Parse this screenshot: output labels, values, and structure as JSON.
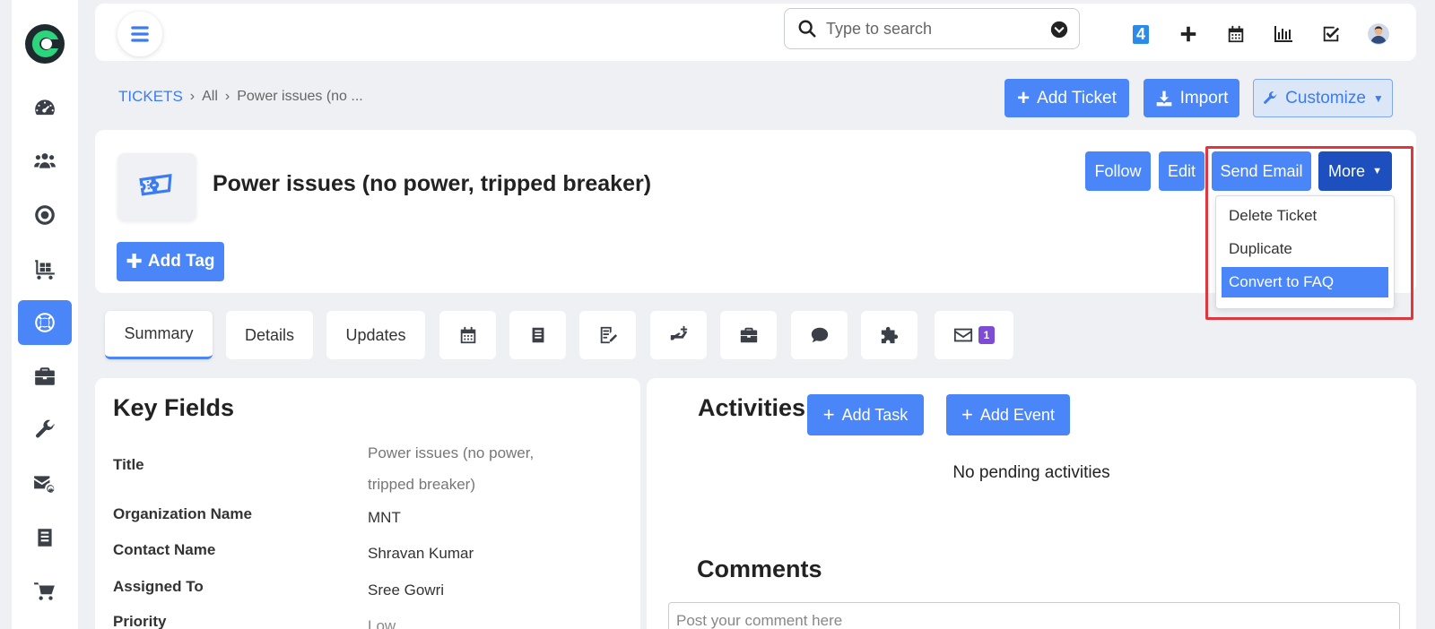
{
  "search": {
    "placeholder": "Type to search"
  },
  "topbar": {
    "notification_count": "4"
  },
  "breadcrumb": {
    "root": "TICKETS",
    "level2": "All",
    "current": "Power issues (no ..."
  },
  "toolbar": {
    "add_ticket": "Add Ticket",
    "import": "Import",
    "customize": "Customize"
  },
  "ticket": {
    "title": "Power issues (no power, tripped breaker)",
    "add_tag": "Add Tag"
  },
  "actions": {
    "follow": "Follow",
    "edit": "Edit",
    "send_email": "Send Email",
    "more": "More"
  },
  "more_menu": {
    "items": [
      "Delete Ticket",
      "Duplicate",
      "Convert to FAQ"
    ]
  },
  "tabs": {
    "summary": "Summary",
    "details": "Details",
    "updates": "Updates",
    "email_count": "1"
  },
  "key_fields": {
    "heading": "Key Fields",
    "rows": [
      {
        "label": "Title",
        "value": "Power issues (no power, tripped breaker)"
      },
      {
        "label": "Organization Name",
        "value": "MNT"
      },
      {
        "label": "Contact Name",
        "value": "Shravan Kumar"
      },
      {
        "label": "Assigned To",
        "value": "Sree Gowri"
      },
      {
        "label": "Priority",
        "value": "Low"
      }
    ]
  },
  "activities": {
    "heading": "Activities",
    "add_task": "Add Task",
    "add_event": "Add Event",
    "empty": "No pending activities",
    "comments_heading": "Comments",
    "comment_placeholder": "Post your comment here"
  },
  "colors": {
    "primary": "#4a86f7",
    "dark_primary": "#1d4fbf",
    "highlight": "#e0373f",
    "badge": "#7d4bd4"
  }
}
